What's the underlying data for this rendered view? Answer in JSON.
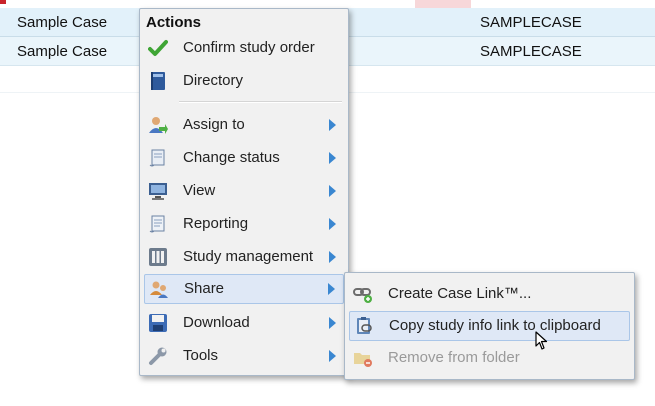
{
  "table": {
    "rows": [
      {
        "name": "Sample Case",
        "code": "SAMPLECASE"
      },
      {
        "name": "Sample Case",
        "code": "SAMPLECASE"
      }
    ]
  },
  "menu": {
    "title": "Actions",
    "items": [
      {
        "label": "Confirm study order",
        "icon": "checkmark-icon"
      },
      {
        "label": "Directory",
        "icon": "book-icon"
      },
      {
        "label": "Assign to",
        "icon": "assign-user-icon"
      },
      {
        "label": "Change status",
        "icon": "scroll-icon"
      },
      {
        "label": "View",
        "icon": "monitor-icon"
      },
      {
        "label": "Reporting",
        "icon": "report-scroll-icon"
      },
      {
        "label": "Study management",
        "icon": "study-management-icon"
      },
      {
        "label": "Share",
        "icon": "share-users-icon"
      },
      {
        "label": "Download",
        "icon": "floppy-disk-icon"
      },
      {
        "label": "Tools",
        "icon": "wrench-icon"
      }
    ]
  },
  "submenu": {
    "items": [
      {
        "label": "Create Case Link™...",
        "icon": "link-add-icon"
      },
      {
        "label": "Copy study info link to clipboard",
        "icon": "clipboard-copy-icon"
      },
      {
        "label": "Remove from folder",
        "icon": "folder-remove-icon"
      }
    ]
  },
  "colors": {
    "arrow": "#3a87d1",
    "highlight": "#dfe8f6",
    "row": "#e2f1fa"
  }
}
